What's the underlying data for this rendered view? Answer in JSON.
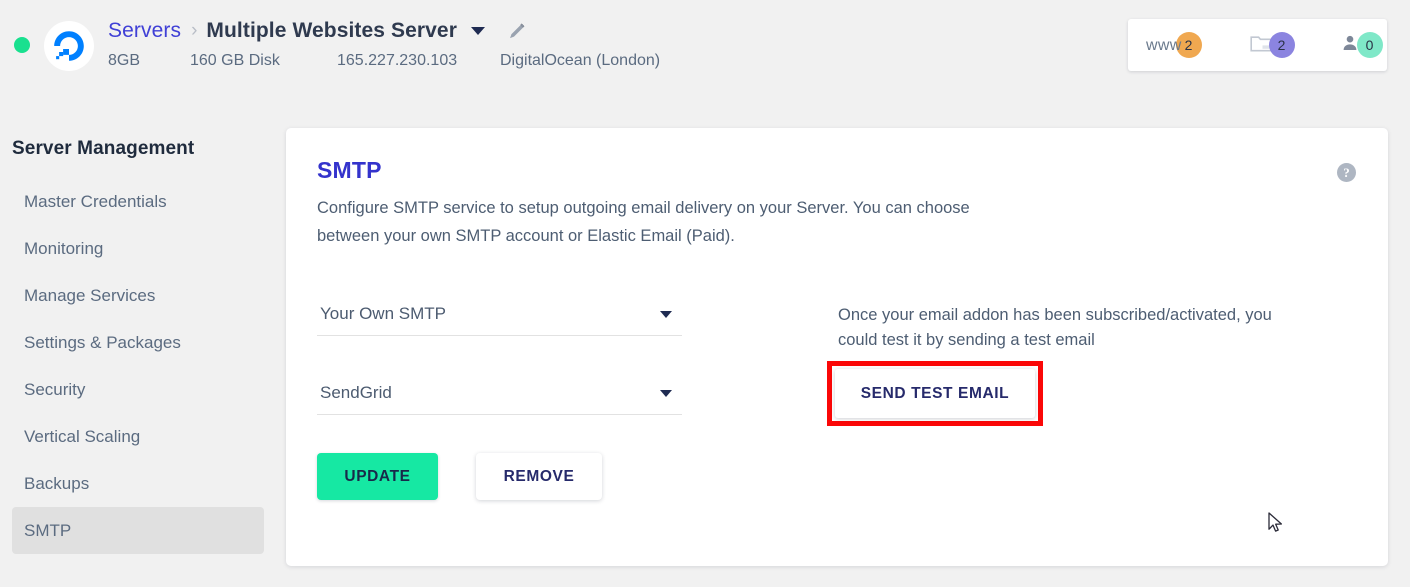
{
  "header": {
    "status_indicator": "online",
    "provider_icon": "digitalocean-logo",
    "breadcrumb": {
      "parent": "Servers",
      "separator": "›",
      "current": "Multiple Websites Server",
      "caret_icon": "chevron-down-icon",
      "edit_icon": "pencil-icon"
    },
    "meta": {
      "ram": "8GB",
      "disk": "160 GB Disk",
      "ip": "165.227.230.103",
      "provider": "DigitalOcean (London)"
    },
    "counters": [
      {
        "icon": "www-label",
        "label": "www",
        "count": "2",
        "color": "#f0a850"
      },
      {
        "icon": "folder-icon",
        "label": "",
        "count": "2",
        "color": "#8b84e0"
      },
      {
        "icon": "user-icon",
        "label": "",
        "count": "0",
        "color": "#7fe8c8"
      }
    ]
  },
  "sidebar": {
    "title": "Server Management",
    "items": [
      {
        "label": "Master Credentials",
        "active": false
      },
      {
        "label": "Monitoring",
        "active": false
      },
      {
        "label": "Manage Services",
        "active": false
      },
      {
        "label": "Settings & Packages",
        "active": false
      },
      {
        "label": "Security",
        "active": false
      },
      {
        "label": "Vertical Scaling",
        "active": false
      },
      {
        "label": "Backups",
        "active": false
      },
      {
        "label": "SMTP",
        "active": true
      }
    ]
  },
  "card": {
    "title": "SMTP",
    "help_icon": "?",
    "description": "Configure SMTP service to setup outgoing email delivery on your Server. You can choose between your own SMTP account or Elastic Email (Paid).",
    "selects": [
      {
        "name": "smtp-provider-type",
        "value": "Your Own SMTP"
      },
      {
        "name": "smtp-service",
        "value": "SendGrid"
      }
    ],
    "buttons": {
      "update": "UPDATE",
      "remove": "REMOVE",
      "send_test": "SEND TEST EMAIL"
    },
    "test_email_note": "Once your email addon has been subscribed/activated, you could test it by sending a test email"
  },
  "colors": {
    "page_bg": "#f1f1f1",
    "card_bg": "#ffffff",
    "accent_blue": "#3433cc",
    "link_blue": "#4040d6",
    "update_green": "#16e8a3",
    "status_green": "#19e08f",
    "highlight_red": "#fb0707",
    "sidebar_active": "#e0e0e0",
    "text_muted": "#4d5d72"
  }
}
